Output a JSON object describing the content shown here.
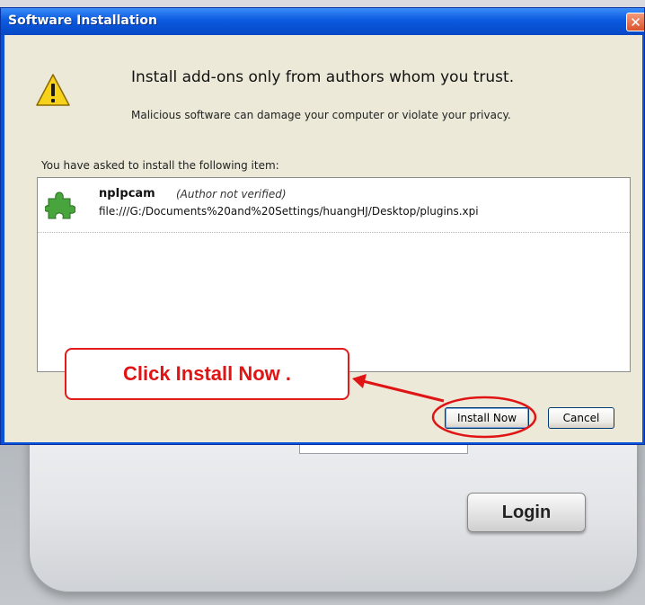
{
  "background_page": {
    "login_label": "Login"
  },
  "dialog": {
    "title": "Software Installation",
    "close_glyph": "✕",
    "headline": "Install add-ons only from authors whom you trust.",
    "subline": "Malicious software can damage your computer or violate your privacy.",
    "list_caption": "You have asked to install the following item:",
    "items": [
      {
        "name": "npIpcam",
        "author_note": "(Author not verified)",
        "url": "file:///G:/Documents%20and%20Settings/huangHJ/Desktop/plugins.xpi",
        "icon": "puzzle-piece-icon"
      }
    ],
    "buttons": {
      "install": "Install Now",
      "cancel": "Cancel"
    }
  },
  "annotation": {
    "callout_text": "Click Install Now .",
    "color": "#e01414"
  },
  "colors": {
    "titlebar": "#0b5ae0",
    "client": "#ece9d8",
    "close": "#d9532c"
  }
}
